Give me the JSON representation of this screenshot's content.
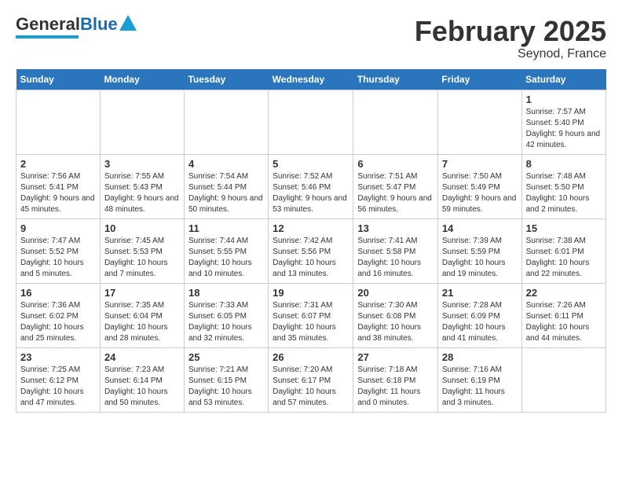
{
  "header": {
    "logo_general": "General",
    "logo_blue": "Blue",
    "month": "February 2025",
    "location": "Seynod, France"
  },
  "days_of_week": [
    "Sunday",
    "Monday",
    "Tuesday",
    "Wednesday",
    "Thursday",
    "Friday",
    "Saturday"
  ],
  "weeks": [
    [
      {
        "day": "",
        "info": ""
      },
      {
        "day": "",
        "info": ""
      },
      {
        "day": "",
        "info": ""
      },
      {
        "day": "",
        "info": ""
      },
      {
        "day": "",
        "info": ""
      },
      {
        "day": "",
        "info": ""
      },
      {
        "day": "1",
        "info": "Sunrise: 7:57 AM\nSunset: 5:40 PM\nDaylight: 9 hours and 42 minutes."
      }
    ],
    [
      {
        "day": "2",
        "info": "Sunrise: 7:56 AM\nSunset: 5:41 PM\nDaylight: 9 hours and 45 minutes."
      },
      {
        "day": "3",
        "info": "Sunrise: 7:55 AM\nSunset: 5:43 PM\nDaylight: 9 hours and 48 minutes."
      },
      {
        "day": "4",
        "info": "Sunrise: 7:54 AM\nSunset: 5:44 PM\nDaylight: 9 hours and 50 minutes."
      },
      {
        "day": "5",
        "info": "Sunrise: 7:52 AM\nSunset: 5:46 PM\nDaylight: 9 hours and 53 minutes."
      },
      {
        "day": "6",
        "info": "Sunrise: 7:51 AM\nSunset: 5:47 PM\nDaylight: 9 hours and 56 minutes."
      },
      {
        "day": "7",
        "info": "Sunrise: 7:50 AM\nSunset: 5:49 PM\nDaylight: 9 hours and 59 minutes."
      },
      {
        "day": "8",
        "info": "Sunrise: 7:48 AM\nSunset: 5:50 PM\nDaylight: 10 hours and 2 minutes."
      }
    ],
    [
      {
        "day": "9",
        "info": "Sunrise: 7:47 AM\nSunset: 5:52 PM\nDaylight: 10 hours and 5 minutes."
      },
      {
        "day": "10",
        "info": "Sunrise: 7:45 AM\nSunset: 5:53 PM\nDaylight: 10 hours and 7 minutes."
      },
      {
        "day": "11",
        "info": "Sunrise: 7:44 AM\nSunset: 5:55 PM\nDaylight: 10 hours and 10 minutes."
      },
      {
        "day": "12",
        "info": "Sunrise: 7:42 AM\nSunset: 5:56 PM\nDaylight: 10 hours and 13 minutes."
      },
      {
        "day": "13",
        "info": "Sunrise: 7:41 AM\nSunset: 5:58 PM\nDaylight: 10 hours and 16 minutes."
      },
      {
        "day": "14",
        "info": "Sunrise: 7:39 AM\nSunset: 5:59 PM\nDaylight: 10 hours and 19 minutes."
      },
      {
        "day": "15",
        "info": "Sunrise: 7:38 AM\nSunset: 6:01 PM\nDaylight: 10 hours and 22 minutes."
      }
    ],
    [
      {
        "day": "16",
        "info": "Sunrise: 7:36 AM\nSunset: 6:02 PM\nDaylight: 10 hours and 25 minutes."
      },
      {
        "day": "17",
        "info": "Sunrise: 7:35 AM\nSunset: 6:04 PM\nDaylight: 10 hours and 28 minutes."
      },
      {
        "day": "18",
        "info": "Sunrise: 7:33 AM\nSunset: 6:05 PM\nDaylight: 10 hours and 32 minutes."
      },
      {
        "day": "19",
        "info": "Sunrise: 7:31 AM\nSunset: 6:07 PM\nDaylight: 10 hours and 35 minutes."
      },
      {
        "day": "20",
        "info": "Sunrise: 7:30 AM\nSunset: 6:08 PM\nDaylight: 10 hours and 38 minutes."
      },
      {
        "day": "21",
        "info": "Sunrise: 7:28 AM\nSunset: 6:09 PM\nDaylight: 10 hours and 41 minutes."
      },
      {
        "day": "22",
        "info": "Sunrise: 7:26 AM\nSunset: 6:11 PM\nDaylight: 10 hours and 44 minutes."
      }
    ],
    [
      {
        "day": "23",
        "info": "Sunrise: 7:25 AM\nSunset: 6:12 PM\nDaylight: 10 hours and 47 minutes."
      },
      {
        "day": "24",
        "info": "Sunrise: 7:23 AM\nSunset: 6:14 PM\nDaylight: 10 hours and 50 minutes."
      },
      {
        "day": "25",
        "info": "Sunrise: 7:21 AM\nSunset: 6:15 PM\nDaylight: 10 hours and 53 minutes."
      },
      {
        "day": "26",
        "info": "Sunrise: 7:20 AM\nSunset: 6:17 PM\nDaylight: 10 hours and 57 minutes."
      },
      {
        "day": "27",
        "info": "Sunrise: 7:18 AM\nSunset: 6:18 PM\nDaylight: 11 hours and 0 minutes."
      },
      {
        "day": "28",
        "info": "Sunrise: 7:16 AM\nSunset: 6:19 PM\nDaylight: 11 hours and 3 minutes."
      },
      {
        "day": "",
        "info": ""
      }
    ]
  ]
}
